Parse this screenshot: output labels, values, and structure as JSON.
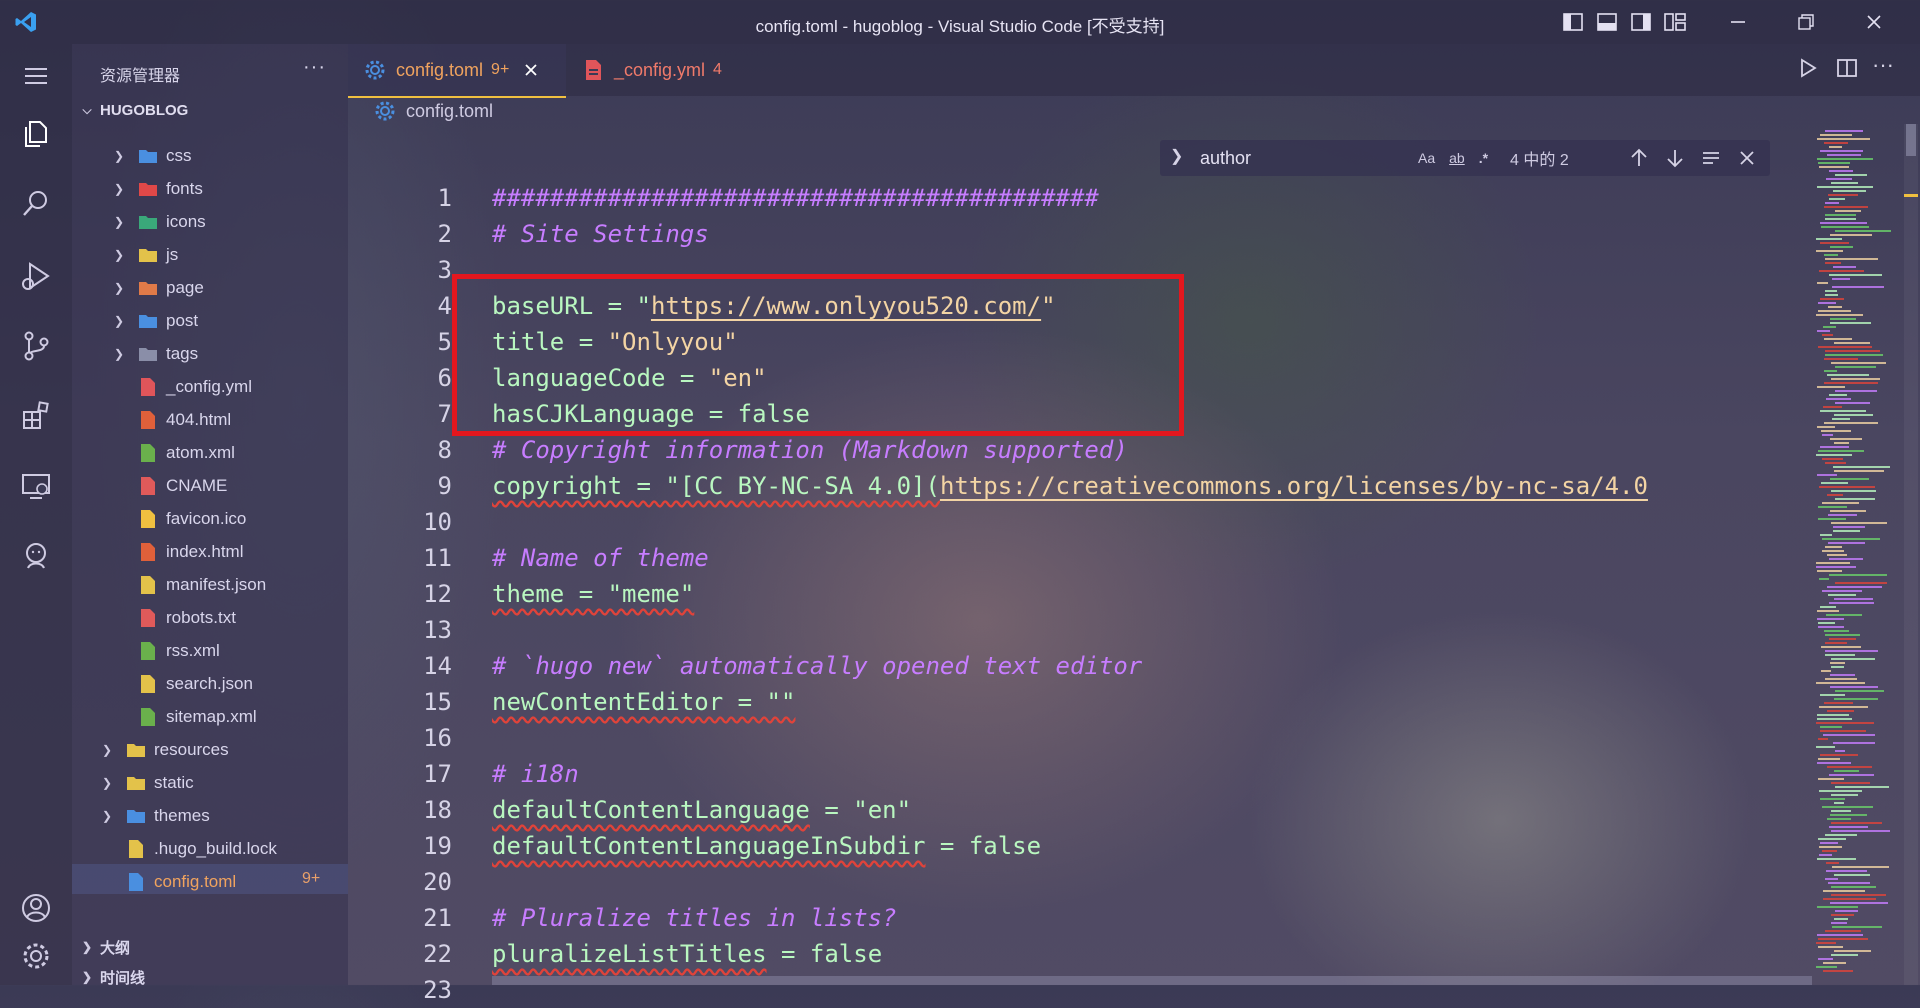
{
  "window": {
    "title": "config.toml - hugoblog - Visual Studio Code [不受支持]"
  },
  "sidebar": {
    "title": "资源管理器",
    "more": "···",
    "root": "HUGOBLOG",
    "items": [
      {
        "label": "css",
        "kind": "folder",
        "color": "#4a8fe0"
      },
      {
        "label": "fonts",
        "kind": "folder",
        "color": "#e04848"
      },
      {
        "label": "icons",
        "kind": "folder",
        "color": "#3aa87a"
      },
      {
        "label": "js",
        "kind": "folder",
        "color": "#e3c24a"
      },
      {
        "label": "page",
        "kind": "folder",
        "color": "#e07a48"
      },
      {
        "label": "post",
        "kind": "folder",
        "color": "#4a8fe0"
      },
      {
        "label": "tags",
        "kind": "folder",
        "color": "#8a8ea8"
      },
      {
        "label": "_config.yml",
        "kind": "file",
        "color": "#e0555a"
      },
      {
        "label": "404.html",
        "kind": "file",
        "color": "#e0603a"
      },
      {
        "label": "atom.xml",
        "kind": "file",
        "color": "#6ab04c"
      },
      {
        "label": "CNAME",
        "kind": "file",
        "color": "#e05a5a"
      },
      {
        "label": "favicon.ico",
        "kind": "file",
        "color": "#f0c040"
      },
      {
        "label": "index.html",
        "kind": "file",
        "color": "#e0603a"
      },
      {
        "label": "manifest.json",
        "kind": "file",
        "color": "#e3c24a"
      },
      {
        "label": "robots.txt",
        "kind": "file",
        "color": "#e05a5a"
      },
      {
        "label": "rss.xml",
        "kind": "file",
        "color": "#6ab04c"
      },
      {
        "label": "search.json",
        "kind": "file",
        "color": "#e3c24a"
      },
      {
        "label": "sitemap.xml",
        "kind": "file",
        "color": "#6ab04c"
      },
      {
        "label": "resources",
        "kind": "folder",
        "color": "#e3c24a"
      },
      {
        "label": "static",
        "kind": "folder",
        "color": "#e3c24a"
      },
      {
        "label": "themes",
        "kind": "folder",
        "color": "#4a8fe0"
      },
      {
        "label": ".hugo_build.lock",
        "kind": "file",
        "color": "#e3c24a"
      },
      {
        "label": "config.toml",
        "kind": "file",
        "color": "#4a8fe0"
      }
    ],
    "selected_badge": "9+",
    "outline": "大纲",
    "timeline": "时间线"
  },
  "tabs": [
    {
      "label": "config.toml",
      "badge": "9+",
      "active": true
    },
    {
      "label": "_config.yml",
      "badge": "4",
      "active": false
    }
  ],
  "breadcrumb": "config.toml",
  "find": {
    "query": "author",
    "match_case": "Aa",
    "whole_word": "ab",
    "regex": ".*",
    "result": "4 中的 2"
  },
  "code": [
    {
      "n": "1",
      "parts": [
        {
          "t": "##########################################",
          "c": "cmt"
        }
      ]
    },
    {
      "n": "2",
      "parts": [
        {
          "t": "# Site Settings",
          "c": "cmt"
        }
      ]
    },
    {
      "n": "3",
      "parts": []
    },
    {
      "n": "4",
      "parts": [
        {
          "t": "baseURL = \"",
          "c": "key"
        },
        {
          "t": "https://www.onlyyou520.com/",
          "c": "str url"
        },
        {
          "t": "\"",
          "c": "str"
        }
      ]
    },
    {
      "n": "5",
      "parts": [
        {
          "t": "title = ",
          "c": "key"
        },
        {
          "t": "\"Onlyyou\"",
          "c": "str"
        }
      ]
    },
    {
      "n": "6",
      "parts": [
        {
          "t": "languageCode = ",
          "c": "key"
        },
        {
          "t": "\"en\"",
          "c": "str"
        }
      ]
    },
    {
      "n": "7",
      "parts": [
        {
          "t": "hasCJKLanguage = false",
          "c": "key"
        }
      ]
    },
    {
      "n": "8",
      "parts": [
        {
          "t": "# Copyright information (Markdown supported)",
          "c": "cmt"
        }
      ]
    },
    {
      "n": "9",
      "parts": [
        {
          "t": "copyright = \"[CC BY-NC-SA 4.0](",
          "c": "key squig"
        },
        {
          "t": "https://creativecommons.org/licenses/by-nc-sa/4.0",
          "c": "str url squig"
        }
      ]
    },
    {
      "n": "10",
      "parts": []
    },
    {
      "n": "11",
      "parts": [
        {
          "t": "# Name of theme",
          "c": "cmt"
        }
      ]
    },
    {
      "n": "12",
      "parts": [
        {
          "t": "theme = \"meme\"",
          "c": "key squig"
        }
      ]
    },
    {
      "n": "13",
      "parts": []
    },
    {
      "n": "14",
      "parts": [
        {
          "t": "# `hugo new` automatically opened text editor",
          "c": "cmt"
        }
      ]
    },
    {
      "n": "15",
      "parts": [
        {
          "t": "newContentEditor = \"\"",
          "c": "key squig"
        }
      ]
    },
    {
      "n": "16",
      "parts": []
    },
    {
      "n": "17",
      "parts": [
        {
          "t": "# i18n",
          "c": "cmt"
        }
      ]
    },
    {
      "n": "18",
      "parts": [
        {
          "t": "defaultContentLanguage",
          "c": "key squig"
        },
        {
          "t": " = \"en\"",
          "c": "key"
        }
      ]
    },
    {
      "n": "19",
      "parts": [
        {
          "t": "defaultContentLanguageInSubdir",
          "c": "key squig"
        },
        {
          "t": " = false",
          "c": "key"
        }
      ]
    },
    {
      "n": "20",
      "parts": []
    },
    {
      "n": "21",
      "parts": [
        {
          "t": "# Pluralize titles in lists?",
          "c": "cmt"
        }
      ]
    },
    {
      "n": "22",
      "parts": [
        {
          "t": "pluralizeListTitles",
          "c": "key squig"
        },
        {
          "t": " = false",
          "c": "key"
        }
      ]
    },
    {
      "n": "23",
      "parts": []
    }
  ]
}
